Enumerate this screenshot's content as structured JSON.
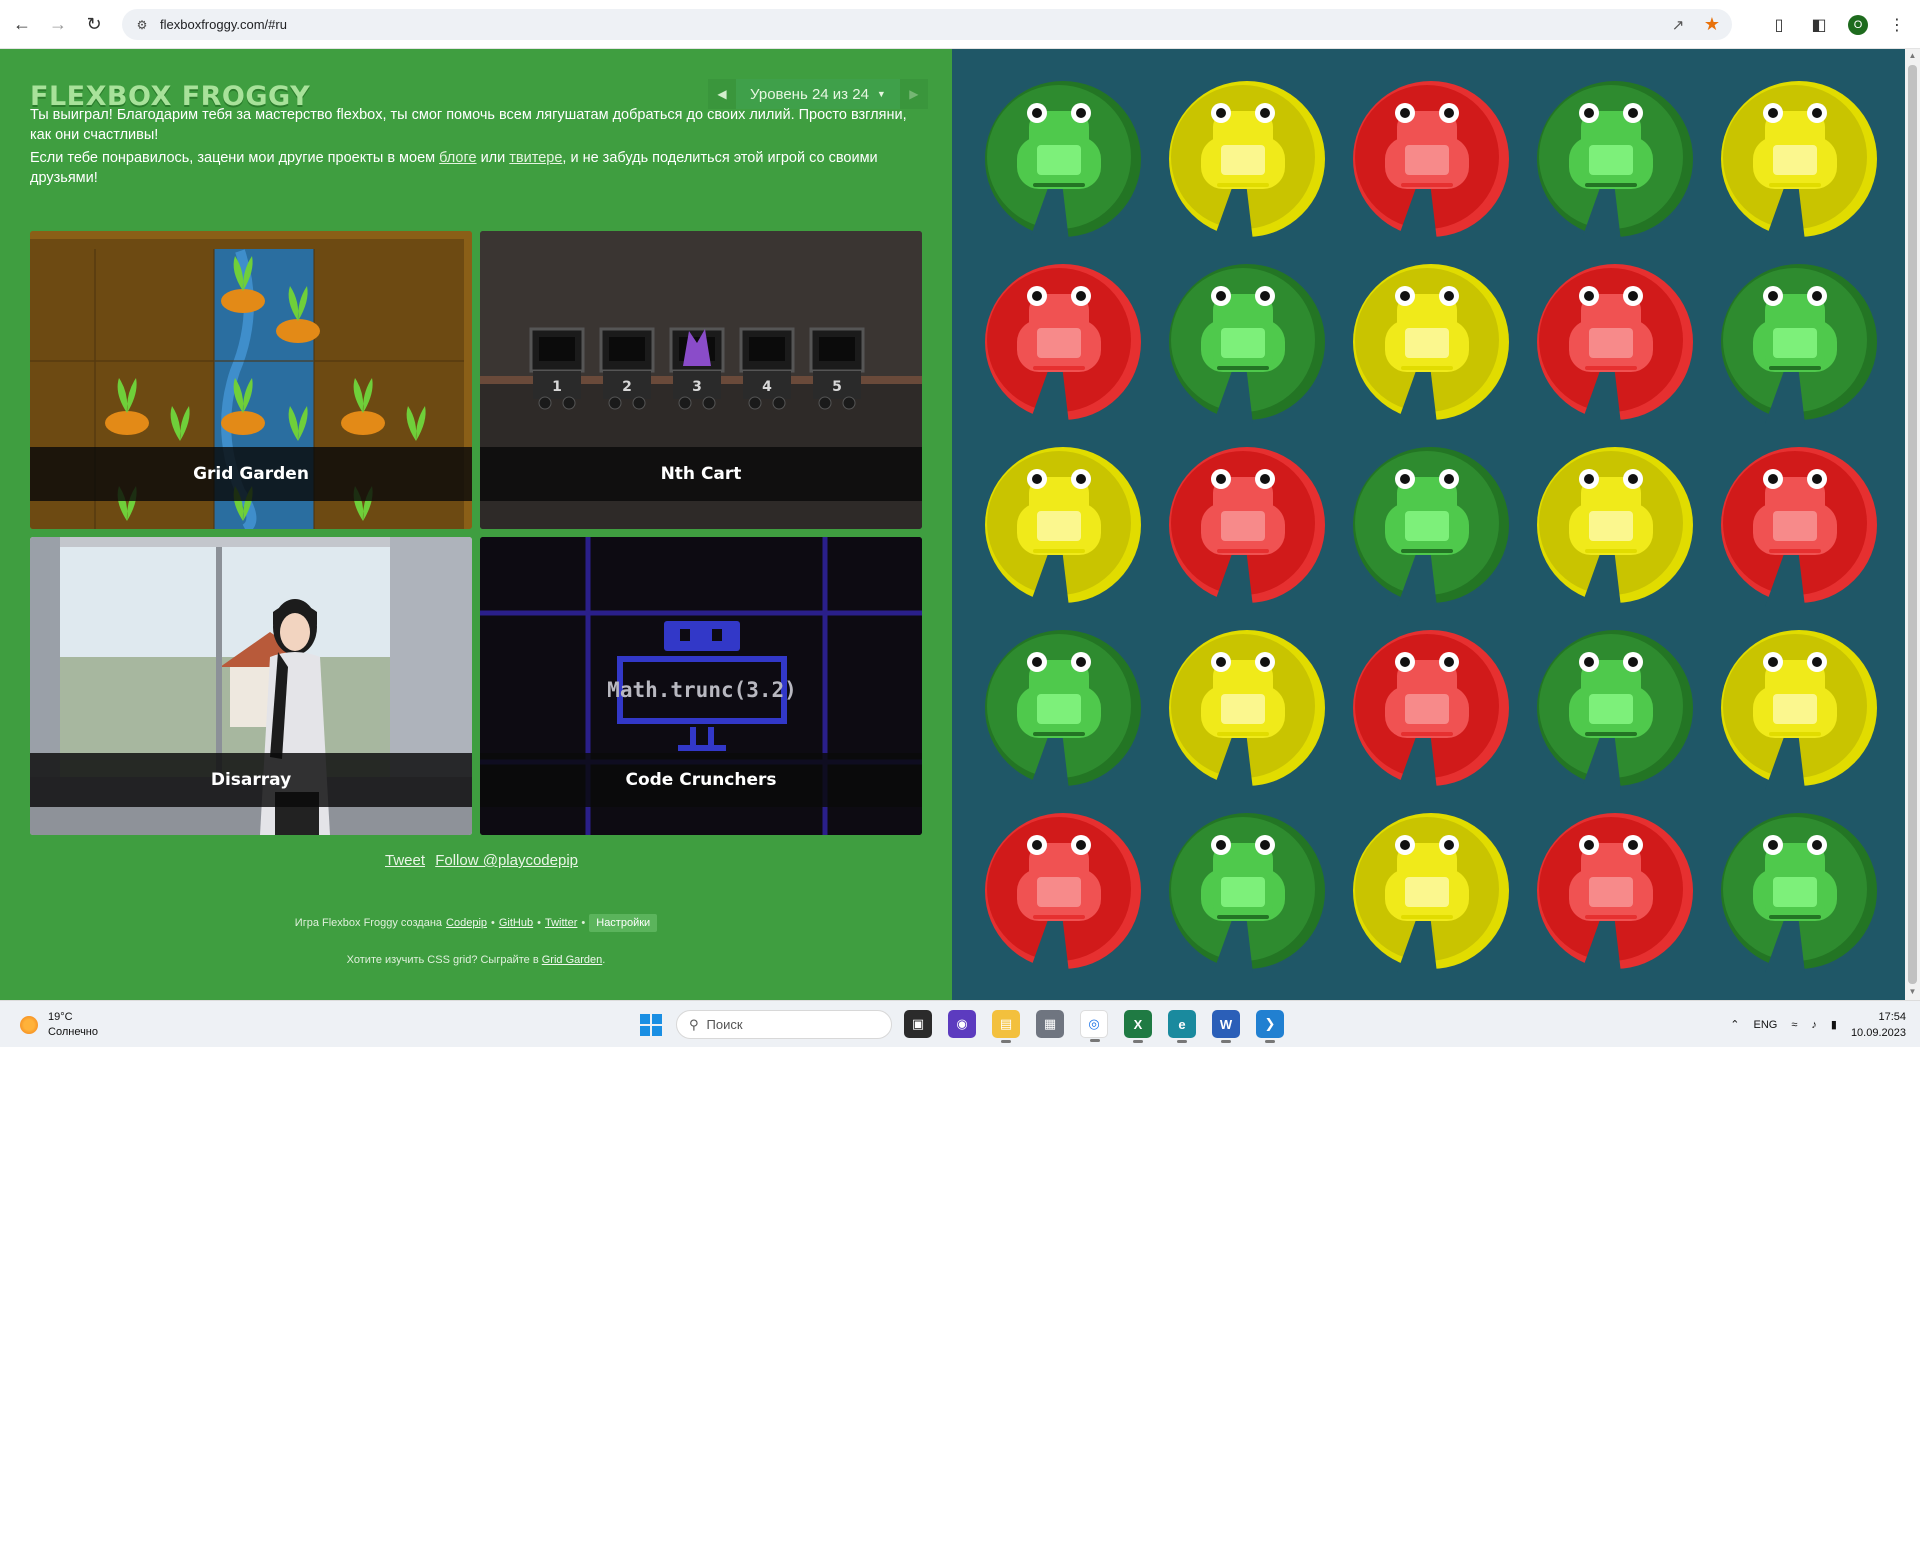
{
  "browser": {
    "url": "flexboxfroggy.com/#ru"
  },
  "header": {
    "logo": "FLEXBOX FROGGY",
    "level_label": "Уровень 24 из 24"
  },
  "content": {
    "win_text": "Ты выиграл! Благодарим тебя за мастерство flexbox, ты смог помочь всем лягушатам добраться до своих лилий. Просто взгляни, как они счастливы!",
    "projects_pre": "Если тебе понравилось, зацени мои другие проекты в моем ",
    "projects_blog": "блоге",
    "projects_mid": " или ",
    "projects_twitter": "твитере",
    "projects_post": ", и не забудь поделиться этой игрой со своими друзьями!"
  },
  "cards": [
    {
      "title": "Grid Garden"
    },
    {
      "title": "Nth Cart"
    },
    {
      "title": "Disarray"
    },
    {
      "title": "Code Crunchers"
    }
  ],
  "nth_cart": {
    "carts": [
      "1",
      "2",
      "3",
      "4",
      "5"
    ]
  },
  "code_crunchers": {
    "code": "Math.trunc(3.2)"
  },
  "social": {
    "tweet": "Tweet",
    "follow": "Follow @playcodepip"
  },
  "footer": {
    "credits_prefix": "Игра Flexbox Froggy создана",
    "codepip": "Codepip",
    "github": "GitHub",
    "twitter": "Twitter",
    "separator": "•",
    "settings": "Настройки",
    "learn_prefix": "Хотите изучить CSS grid? Сыграйте в",
    "learn_link": "Grid Garden",
    "learn_suffix": "."
  },
  "board": {
    "frog_colors": [
      [
        "green",
        "yellow",
        "red",
        "green",
        "yellow"
      ],
      [
        "red",
        "green",
        "yellow",
        "red",
        "green"
      ],
      [
        "yellow",
        "red",
        "green",
        "yellow",
        "red"
      ],
      [
        "green",
        "yellow",
        "red",
        "green",
        "yellow"
      ],
      [
        "red",
        "green",
        "yellow",
        "red",
        "green"
      ]
    ],
    "palette": {
      "green": {
        "pad": "#2e8b2f",
        "pad_dark": "#237524",
        "body": "#4fc94c",
        "belly": "#7df07a"
      },
      "yellow": {
        "pad": "#c9c400",
        "pad_dark": "#e1dc00",
        "body": "#f0ea1a",
        "belly": "#fbf78e"
      },
      "red": {
        "pad": "#d11a1a",
        "pad_dark": "#e63030",
        "body": "#f05252",
        "belly": "#f78a8a"
      }
    }
  },
  "taskbar": {
    "weather_temp": "19°C",
    "weather_desc": "Солнечно",
    "search_placeholder": "Поиск",
    "language": "ENG",
    "time": "17:54",
    "date": "10.09.2023"
  },
  "colors": {
    "left_bg": "#3f9e40",
    "right_bg": "#1f5767",
    "logo": "#a8e29a"
  }
}
